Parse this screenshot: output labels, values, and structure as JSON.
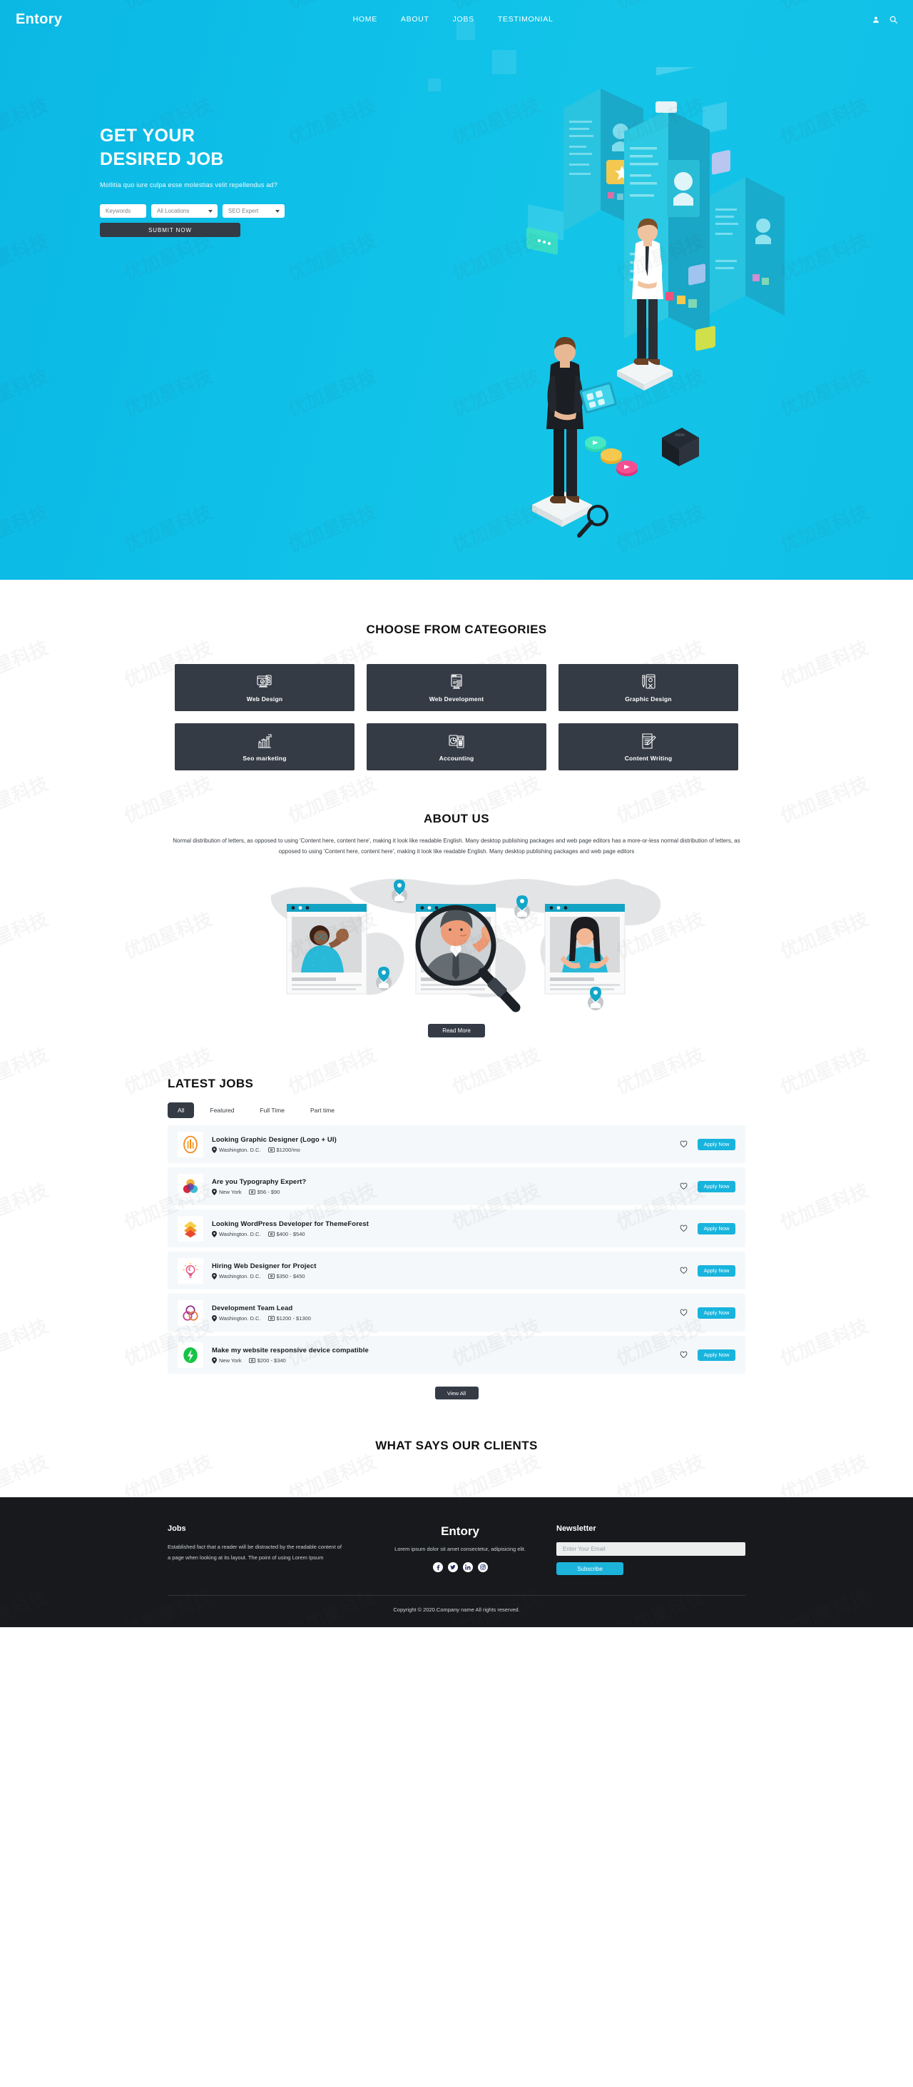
{
  "header": {
    "brand": "Entory",
    "nav": [
      {
        "label": "HOME"
      },
      {
        "label": "ABOUT"
      },
      {
        "label": "JOBS"
      },
      {
        "label": "TESTIMONIAL"
      }
    ],
    "user_icon": "user-icon",
    "search_icon": "search-icon"
  },
  "hero": {
    "title_line1": "GET YOUR",
    "title_line2": "DESIRED JOB",
    "subtitle": "Mollitia quo iure culpa esse molestias velit repellendus ad?",
    "keywords_placeholder": "Keywords",
    "location_value": "All Locations",
    "expertise_value": "SEO Expert",
    "submit_label": "SUBMIT NOW",
    "bg_color": "#0fbfe6"
  },
  "categories": {
    "title": "CHOOSE FROM CATEGORIES",
    "card_bg": "#343b45",
    "items": [
      {
        "label": "Web Design",
        "icon": "web-design-icon"
      },
      {
        "label": "Web Development",
        "icon": "web-development-icon"
      },
      {
        "label": "Graphic Design",
        "icon": "graphic-design-icon"
      },
      {
        "label": "Seo marketing",
        "icon": "seo-marketing-icon"
      },
      {
        "label": "Accounting",
        "icon": "accounting-icon"
      },
      {
        "label": "Content Writing",
        "icon": "content-writing-icon"
      }
    ]
  },
  "about": {
    "title": "ABOUT US",
    "body": "Normal distribution of letters, as opposed to using 'Content here, content here', making it look like readable English. Many desktop publishing packages and web page editors has a more-or-less normal distribution of letters, as opposed to using 'Content here, content here', making it look like readable English. Many desktop publishing packages and web page editors",
    "read_more_label": "Read More"
  },
  "jobs": {
    "title": "LATEST JOBS",
    "tabs": [
      {
        "label": "All",
        "active": true
      },
      {
        "label": "Featured",
        "active": false
      },
      {
        "label": "Full Time",
        "active": false
      },
      {
        "label": "Part time",
        "active": false
      }
    ],
    "apply_label": "Apply Now",
    "view_all_label": "View All",
    "accent_color": "#18b4dd",
    "items": [
      {
        "title": "Looking Graphic Designer (Logo + UI)",
        "location": "Washington. D.C.",
        "salary": "$1200/mo",
        "logo": "orange-building-logo"
      },
      {
        "title": "Are you Typography Expert?",
        "location": "New York",
        "salary": "$56 - $90",
        "logo": "color-circles-logo"
      },
      {
        "title": "Looking WordPress Developer for ThemeForest",
        "location": "Washington. D.C.",
        "salary": "$400 - $540",
        "logo": "stacked-diamonds-logo"
      },
      {
        "title": "Hiring Web Designer for Project",
        "location": "Washington. D.C.",
        "salary": "$350 - $450",
        "logo": "lightbulb-logo"
      },
      {
        "title": "Development Team Lead",
        "location": "Washington. D.C.",
        "salary": "$1200 - $1300",
        "logo": "interlocking-rings-logo"
      },
      {
        "title": "Make my website responsive device compatible",
        "location": "New York",
        "salary": "$200 - $340",
        "logo": "green-bolt-logo"
      }
    ]
  },
  "testimonial": {
    "title": "WHAT SAYS OUR CLIENTS"
  },
  "footer": {
    "jobs_heading": "Jobs",
    "jobs_text": "Established fact that a reader will be distracted by the readable content of a page when looking at its layout. The point of using Lorem Ipsum",
    "brand": "Entory",
    "brand_text": "Lorem ipsum dolor sit amet consectetur, adipisicing elit.",
    "socials": [
      {
        "name": "facebook-icon"
      },
      {
        "name": "twitter-icon"
      },
      {
        "name": "linkedin-icon"
      },
      {
        "name": "instagram-icon"
      }
    ],
    "newsletter_heading": "Newsletter",
    "email_placeholder": "Enter Your Email",
    "subscribe_label": "Subscribe",
    "copyright": "Copyright © 2020.Company name All rights reserved.",
    "bg_color": "#17191c"
  },
  "watermark": {
    "text": "优加星科技"
  }
}
